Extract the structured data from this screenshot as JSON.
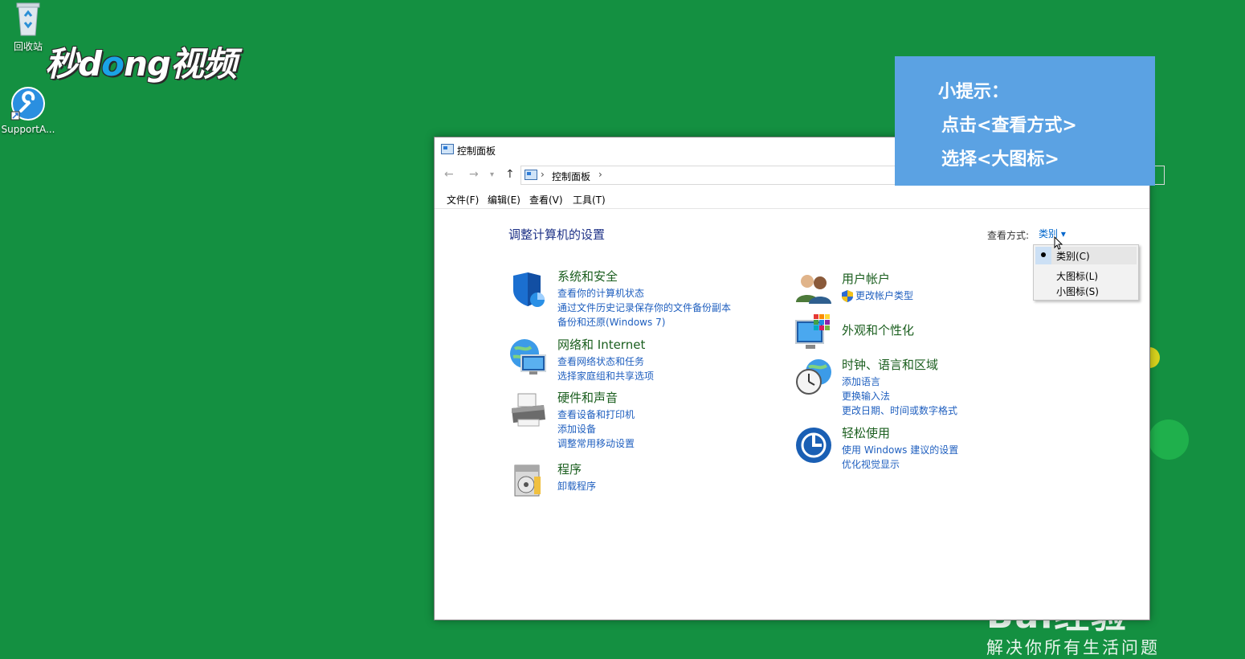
{
  "desktop": {
    "recycle_bin_label": "回收站",
    "support_label": "SupportA..."
  },
  "watermark": {
    "logo_a": "秒d",
    "logo_o": "o",
    "logo_b": "ng视频",
    "baidu_big": "Bai经验",
    "baidu_sub": "解决你所有生活问题"
  },
  "tip": {
    "line1": "小提示：",
    "line2": "点击<查看方式>",
    "line3": "选择<大图标>"
  },
  "window": {
    "title": "控制面板",
    "breadcrumb": "控制面板",
    "menu": [
      "文件(F)",
      "编辑(E)",
      "查看(V)",
      "工具(T)"
    ],
    "heading": "调整计算机的设置",
    "view_by_label": "查看方式:",
    "view_by_value": "类别 ▾",
    "dropdown": [
      "类别(C)",
      "大图标(L)",
      "小图标(S)"
    ]
  },
  "categories_left": [
    {
      "title": "系统和安全",
      "links": [
        "查看你的计算机状态",
        "通过文件历史记录保存你的文件备份副本",
        "备份和还原(Windows 7)"
      ]
    },
    {
      "title": "网络和 Internet",
      "links": [
        "查看网络状态和任务",
        "选择家庭组和共享选项"
      ]
    },
    {
      "title": "硬件和声音",
      "links": [
        "查看设备和打印机",
        "添加设备",
        "调整常用移动设置"
      ]
    },
    {
      "title": "程序",
      "links": [
        "卸载程序"
      ]
    }
  ],
  "categories_right": [
    {
      "title": "用户帐户",
      "links": [
        "更改帐户类型"
      ]
    },
    {
      "title": "外观和个性化",
      "links": []
    },
    {
      "title": "时钟、语言和区域",
      "links": [
        "添加语言",
        "更换输入法",
        "更改日期、时间或数字格式"
      ]
    },
    {
      "title": "轻松使用",
      "links": [
        "使用 Windows 建议的设置",
        "优化视觉显示"
      ]
    }
  ]
}
